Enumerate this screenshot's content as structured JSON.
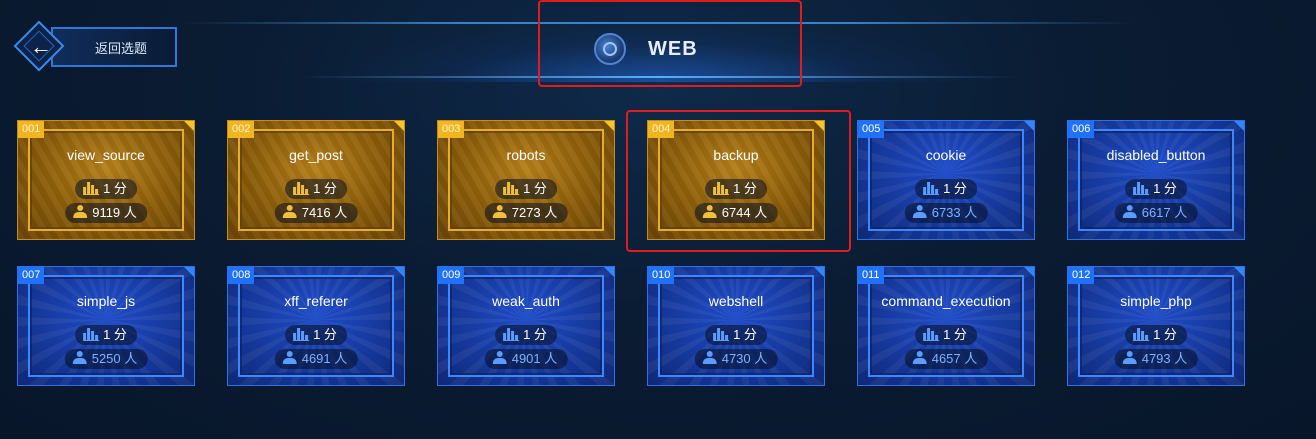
{
  "header": {
    "back_label": "返回选题",
    "title": "WEB"
  },
  "colors": {
    "solved_card": "#a06d10",
    "unsolved_card": "#1a43b5",
    "highlight": "#e21c1c"
  },
  "icons": {
    "back": "arrow-left-icon",
    "category": "globe-icon",
    "score": "bar-chart-icon",
    "people": "user-icon"
  },
  "challenges": [
    {
      "num": "001",
      "name": "view_source",
      "score": "1 分",
      "people": "9119 人",
      "status": "solved"
    },
    {
      "num": "002",
      "name": "get_post",
      "score": "1 分",
      "people": "7416 人",
      "status": "solved"
    },
    {
      "num": "003",
      "name": "robots",
      "score": "1 分",
      "people": "7273 人",
      "status": "solved"
    },
    {
      "num": "004",
      "name": "backup",
      "score": "1 分",
      "people": "6744 人",
      "status": "solved"
    },
    {
      "num": "005",
      "name": "cookie",
      "score": "1 分",
      "people": "6733 人",
      "status": "unsolved"
    },
    {
      "num": "006",
      "name": "disabled_button",
      "score": "1 分",
      "people": "6617 人",
      "status": "unsolved"
    },
    {
      "num": "007",
      "name": "simple_js",
      "score": "1 分",
      "people": "5250 人",
      "status": "unsolved"
    },
    {
      "num": "008",
      "name": "xff_referer",
      "score": "1 分",
      "people": "4691 人",
      "status": "unsolved"
    },
    {
      "num": "009",
      "name": "weak_auth",
      "score": "1 分",
      "people": "4901 人",
      "status": "unsolved"
    },
    {
      "num": "010",
      "name": "webshell",
      "score": "1 分",
      "people": "4730 人",
      "status": "unsolved"
    },
    {
      "num": "011",
      "name": "command_execution",
      "score": "1 分",
      "people": "4657 人",
      "status": "unsolved"
    },
    {
      "num": "012",
      "name": "simple_php",
      "score": "1 分",
      "people": "4793 人",
      "status": "unsolved"
    }
  ]
}
